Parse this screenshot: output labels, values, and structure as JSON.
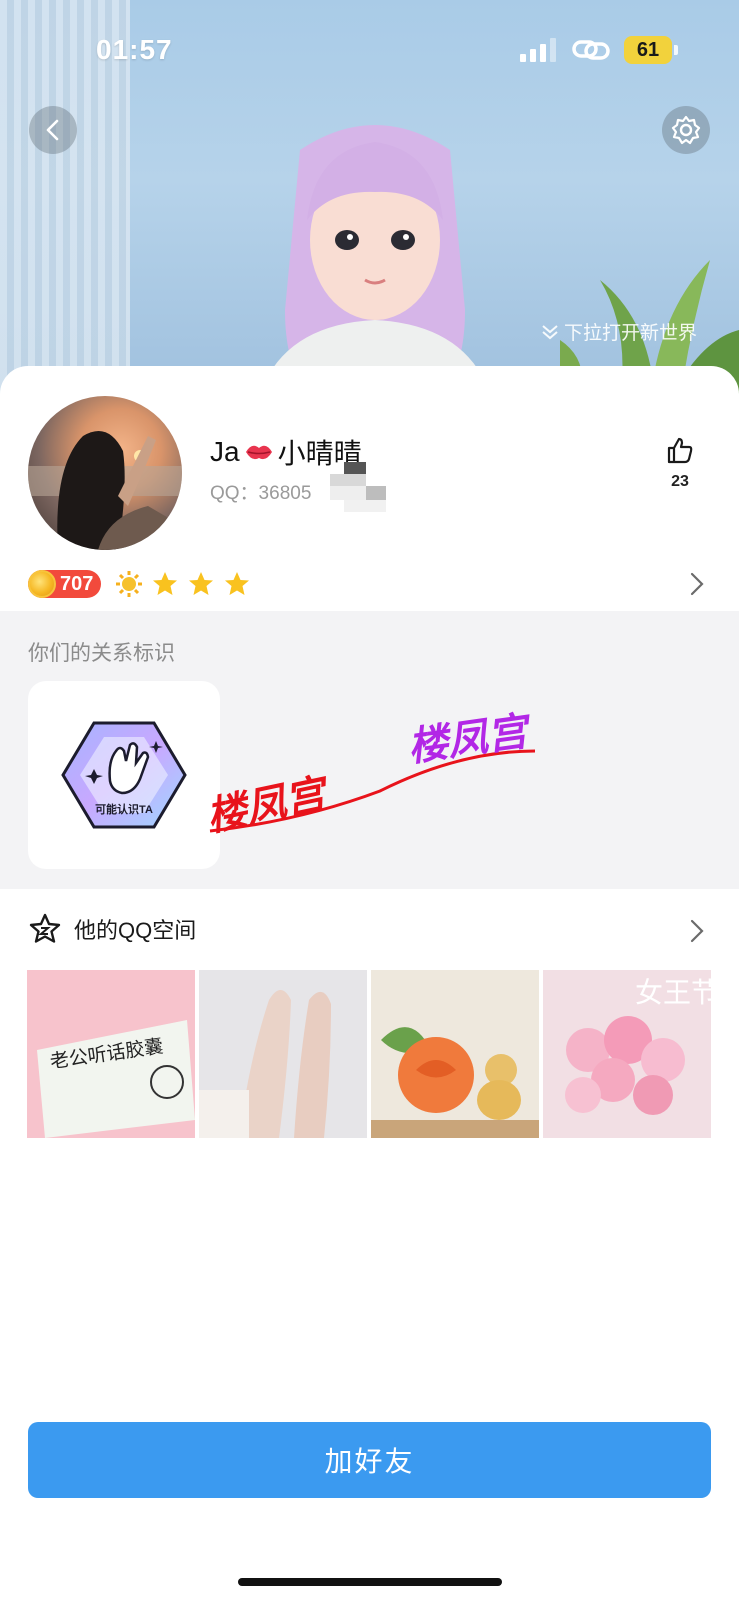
{
  "status_bar": {
    "time": "01:57",
    "battery": "61"
  },
  "header": {
    "pull_hint": "下拉打开新世界"
  },
  "profile": {
    "nickname_prefix": "Ja",
    "nickname_suffix": "小晴晴",
    "qq_number": "QQ：36805",
    "likes": "23",
    "coin_level": "707"
  },
  "relation": {
    "title": "你们的关系标识",
    "badge_label": "可能认识TA"
  },
  "watermark": {
    "text_1": "楼凤宫",
    "text_2": "楼凤宫"
  },
  "qzone": {
    "title": "他的QQ空间",
    "photo_captions": [
      "老公听话胶囊",
      "",
      "",
      "女王节"
    ]
  },
  "actions": {
    "add_friend": "加好友"
  },
  "colors": {
    "accent": "#3b9af0",
    "coin_badge": "#f24a3c",
    "watermark_red": "#e8131b",
    "watermark_purple": "#b227e6"
  }
}
